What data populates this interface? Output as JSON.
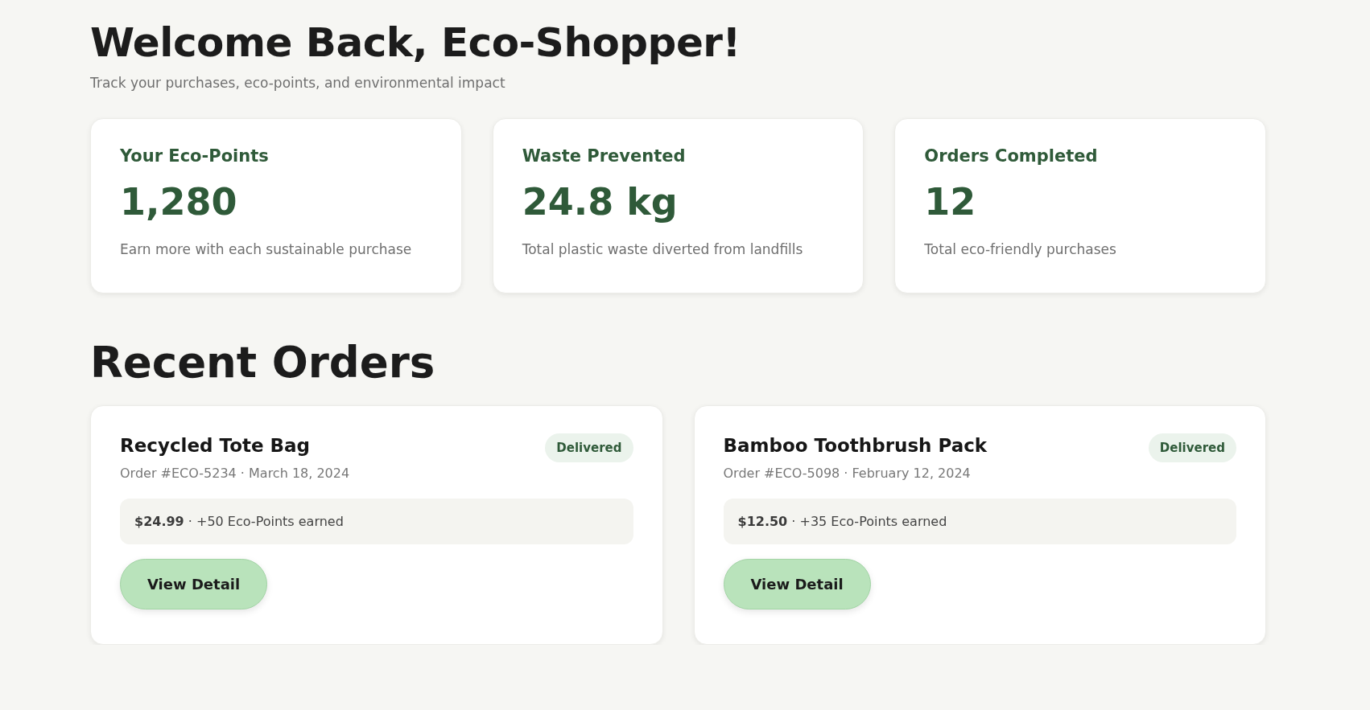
{
  "header": {
    "title": "Welcome Back, Eco-Shopper!",
    "subtitle": "Track your purchases, eco-points, and environmental impact"
  },
  "stats": [
    {
      "label": "Your Eco-Points",
      "value": "1,280",
      "note": "Earn more with each sustainable purchase"
    },
    {
      "label": "Waste Prevented",
      "value": "24.8 kg",
      "note": "Total plastic waste diverted from landfills"
    },
    {
      "label": "Orders Completed",
      "value": "12",
      "note": "Total eco-friendly purchases"
    }
  ],
  "recent_orders": {
    "heading": "Recent Orders",
    "orders": [
      {
        "name": "Recycled Tote Bag",
        "meta": "Order #ECO-5234 · March 18, 2024",
        "status": "Delivered",
        "summary": "**$24.99** · +50 Eco-Points earned",
        "button": "View Detail"
      },
      {
        "name": "Bamboo Toothbrush Pack",
        "meta": "Order #ECO-5098 · February 12, 2024",
        "status": "Delivered",
        "summary": "**$12.50** · +35 Eco-Points earned",
        "button": "View Detail"
      }
    ]
  }
}
